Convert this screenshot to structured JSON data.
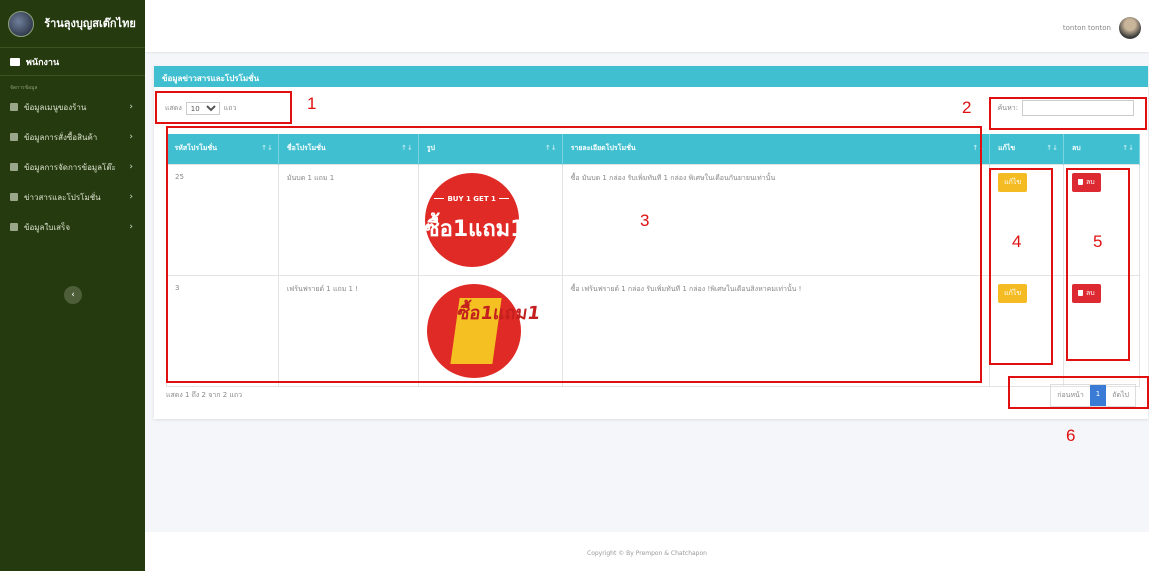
{
  "sidebar": {
    "brand_name": "ร้านลุงบุญสเต๊กไทย",
    "user_label": "พนักงาน",
    "section_label": "จัดการข้อมูล",
    "items": [
      {
        "label": "ข้อมูลเมนูของร้าน",
        "icon": "menu-icon"
      },
      {
        "label": "ข้อมูลการสั่งซื้อสินค้า",
        "icon": "cart-icon"
      },
      {
        "label": "ข้อมูลการจัดการข้อมูลโต๊ะ",
        "icon": "table-icon"
      },
      {
        "label": "ข่าวสารและโปรโมชั่น",
        "icon": "megaphone-icon"
      },
      {
        "label": "ข้อมูลใบเสร็จ",
        "icon": "receipt-icon"
      }
    ],
    "collapse_label": "‹"
  },
  "topbar": {
    "username": "tonton tonton"
  },
  "card": {
    "title": "ข้อมูลข่าวสารและโปรโมชั่น",
    "show_prefix": "แสดง",
    "show_value": "10",
    "show_suffix": "แถว",
    "search_label": "ค้นหา:",
    "search_placeholder": ""
  },
  "table": {
    "headers": [
      "รหัสโปรโมชั่น",
      "ชื่อโปรโมชั่น",
      "รูป",
      "รายละเอียดโปรโมชั่น",
      "แก้ไข",
      "ลบ"
    ],
    "rows": [
      {
        "id": "25",
        "name": "มันบด 1 แถม 1",
        "image_top": "BUY 1 GET 1",
        "image_text": "ซื้อ1แถม1",
        "detail": "ซื้อ มันบด 1 กล่อง รับเพิ่มทันที 1 กล่อง พิเศษในเดือนกันยายนเท่านั้น",
        "edit_label": "แก้ไข",
        "delete_label": "ลบ"
      },
      {
        "id": "3",
        "name": "เฟร้นฟรายด์ 1 แถม 1 !",
        "image_text": "ซื้อ1แถม1",
        "detail": "ซื้อ เฟร้นฟรายด์ 1 กล่อง รับเพิ่มทันที 1 กล่อง !พิเศษในเดือนสิงหาคมเท่านั้น !",
        "edit_label": "แก้ไข",
        "delete_label": "ลบ"
      }
    ],
    "info": "แสดง 1 ถึง 2 จาก 2 แถว"
  },
  "pagination": {
    "prev": "ก่อนหน้า",
    "current": "1",
    "next": "ถัดไป"
  },
  "footer": {
    "text": "Copyright © By Prempon & Chatchapon"
  },
  "annotations": [
    "1",
    "2",
    "3",
    "4",
    "5",
    "6"
  ],
  "colors": {
    "sidebar": "#253a0f",
    "header": "#3fbfd0",
    "edit": "#f5bb22",
    "delete": "#dd2a32",
    "annotation": "#e01010"
  }
}
